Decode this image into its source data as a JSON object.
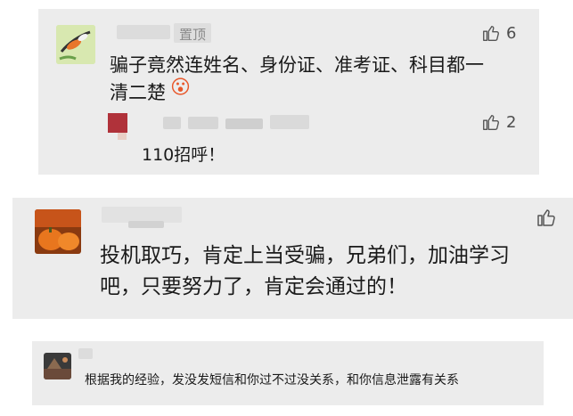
{
  "comments": [
    {
      "pin_label": "置顶",
      "text_line1": "骗子竟然连姓名、身份证、准考证、科目都一",
      "text_line2": "清二楚",
      "emoji": "😮",
      "likes": "6",
      "reply": {
        "text": "110招呼！",
        "likes": "2"
      }
    },
    {
      "text_line1": "投机取巧，肯定上当受骗，兄弟们，加油学习",
      "text_line2": "吧，只要努力了，肯定会通过的！"
    },
    {
      "text": "根据我的经验，发没发短信和你过不过没关系，和你信息泄露有关系"
    }
  ],
  "icons": {
    "like": "thumbs-up-icon"
  }
}
